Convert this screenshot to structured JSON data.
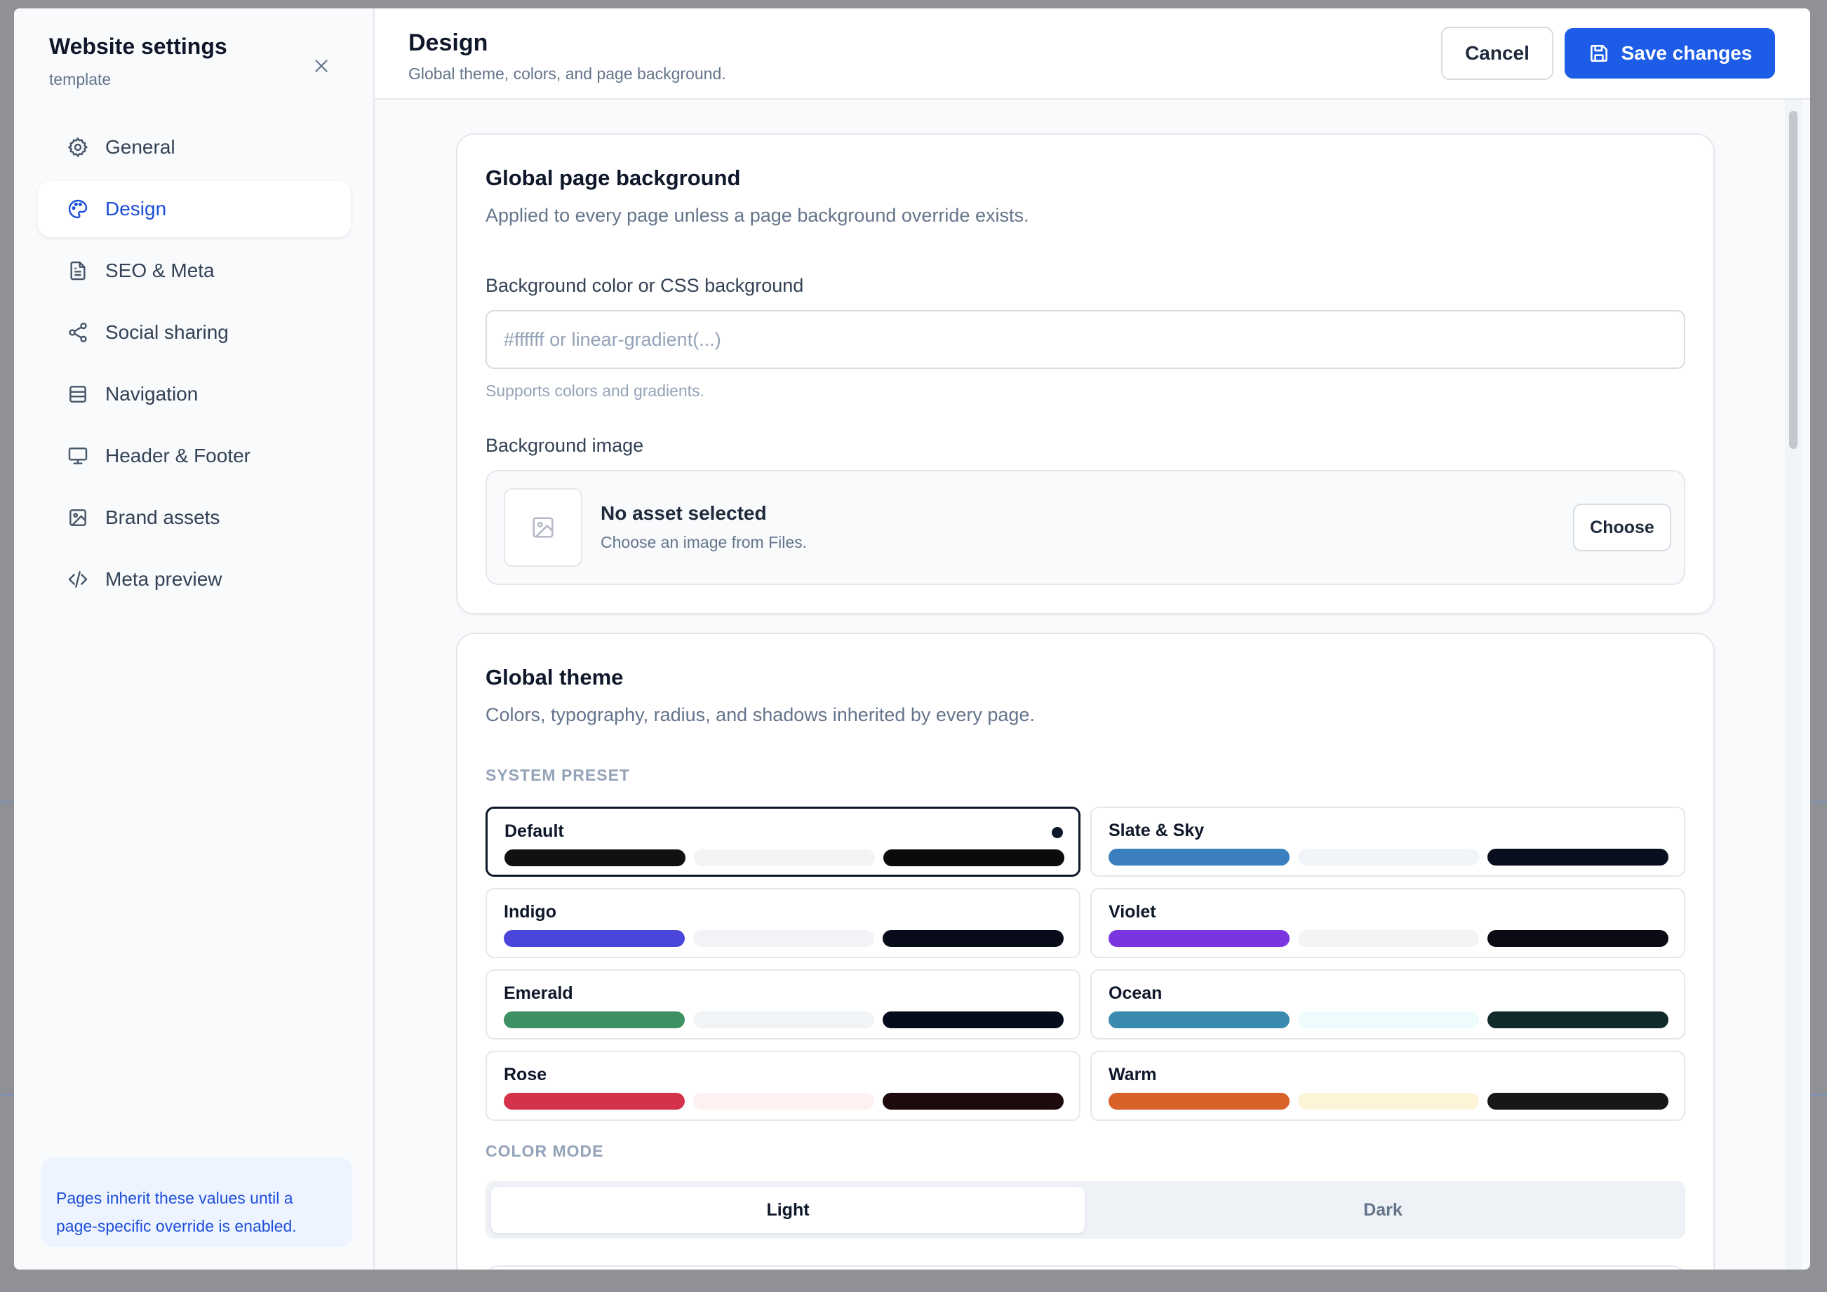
{
  "sidebar": {
    "title": "Website settings",
    "subtitle": "template",
    "items": [
      {
        "label": "General",
        "icon": "gear-icon"
      },
      {
        "label": "Design",
        "icon": "palette-icon",
        "active": true
      },
      {
        "label": "SEO & Meta",
        "icon": "document-icon"
      },
      {
        "label": "Social sharing",
        "icon": "share-icon"
      },
      {
        "label": "Navigation",
        "icon": "layout-rows-icon"
      },
      {
        "label": "Header & Footer",
        "icon": "monitor-icon"
      },
      {
        "label": "Brand assets",
        "icon": "image-icon"
      },
      {
        "label": "Meta preview",
        "icon": "code-icon"
      }
    ],
    "note": "Pages inherit these values until a page-specific override is enabled."
  },
  "header": {
    "title": "Design",
    "subtitle": "Global theme, colors, and page background.",
    "cancel_label": "Cancel",
    "save_label": "Save changes"
  },
  "background_card": {
    "title": "Global page background",
    "description": "Applied to every page unless a page background override exists.",
    "color_label": "Background color or CSS background",
    "color_value": "",
    "color_placeholder": "#ffffff or linear-gradient(...)",
    "color_help": "Supports colors and gradients.",
    "image_label": "Background image",
    "asset_name": "No asset selected",
    "asset_hint": "Choose an image from Files.",
    "choose_label": "Choose"
  },
  "theme_card": {
    "title": "Global theme",
    "description": "Colors, typography, radius, and shadows inherited by every page.",
    "preset_section": "SYSTEM PRESET",
    "presets": [
      {
        "name": "Default",
        "selected": true,
        "colors": [
          "#111111",
          "#f3f4f6",
          "#0b0b0b"
        ]
      },
      {
        "name": "Slate & Sky",
        "selected": false,
        "colors": [
          "#3b7fbf",
          "#f1f5f9",
          "#0a0f1f"
        ]
      },
      {
        "name": "Indigo",
        "selected": false,
        "colors": [
          "#4a46dc",
          "#f1f3f6",
          "#070b1a"
        ]
      },
      {
        "name": "Violet",
        "selected": false,
        "colors": [
          "#7a35e0",
          "#f3f4f6",
          "#0a0b14"
        ]
      },
      {
        "name": "Emerald",
        "selected": false,
        "colors": [
          "#3e9163",
          "#f1f4f6",
          "#060b1c"
        ]
      },
      {
        "name": "Ocean",
        "selected": false,
        "colors": [
          "#3a8bad",
          "#eefbfc",
          "#0f2a28"
        ]
      },
      {
        "name": "Rose",
        "selected": false,
        "colors": [
          "#d3324a",
          "#fdf1f1",
          "#1d0a0c"
        ]
      },
      {
        "name": "Warm",
        "selected": false,
        "colors": [
          "#d9612a",
          "#fdf3d6",
          "#171717"
        ]
      }
    ],
    "mode_section": "COLOR MODE",
    "mode_options": [
      "Light",
      "Dark"
    ],
    "mode_selected": "Light"
  },
  "colors": {
    "accent": "#1d5ce6",
    "active_nav": "#1d4ed8",
    "note_bg": "#eef4ff"
  }
}
